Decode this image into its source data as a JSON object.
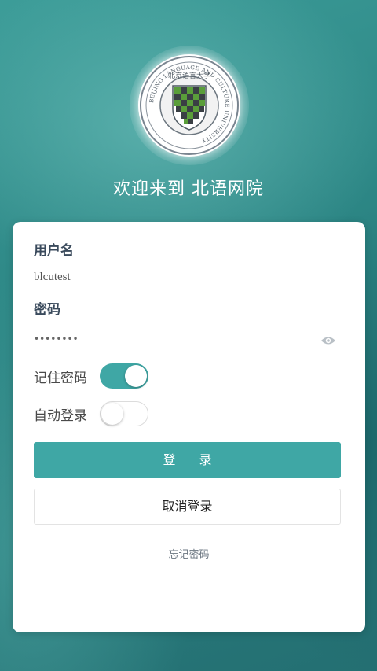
{
  "header": {
    "welcome": "欢迎来到 北语网院",
    "logo_text": "BEIJING LANGUAGE AND CULTURE UNIVERSITY",
    "logo_icon": "university-seal-icon"
  },
  "form": {
    "username_label": "用户名",
    "username_value": "blcutest",
    "password_label": "密码",
    "password_value": "••••••••",
    "password_toggle_icon": "eye-icon",
    "remember_label": "记住密码",
    "remember_on": true,
    "autologin_label": "自动登录",
    "autologin_on": false,
    "login_button": "登录",
    "cancel_button": "取消登录",
    "forgot_link": "忘记密码"
  },
  "colors": {
    "accent": "#3fa7a5",
    "background": "#2f8a8a",
    "seal_green": "#5a9e3a"
  }
}
